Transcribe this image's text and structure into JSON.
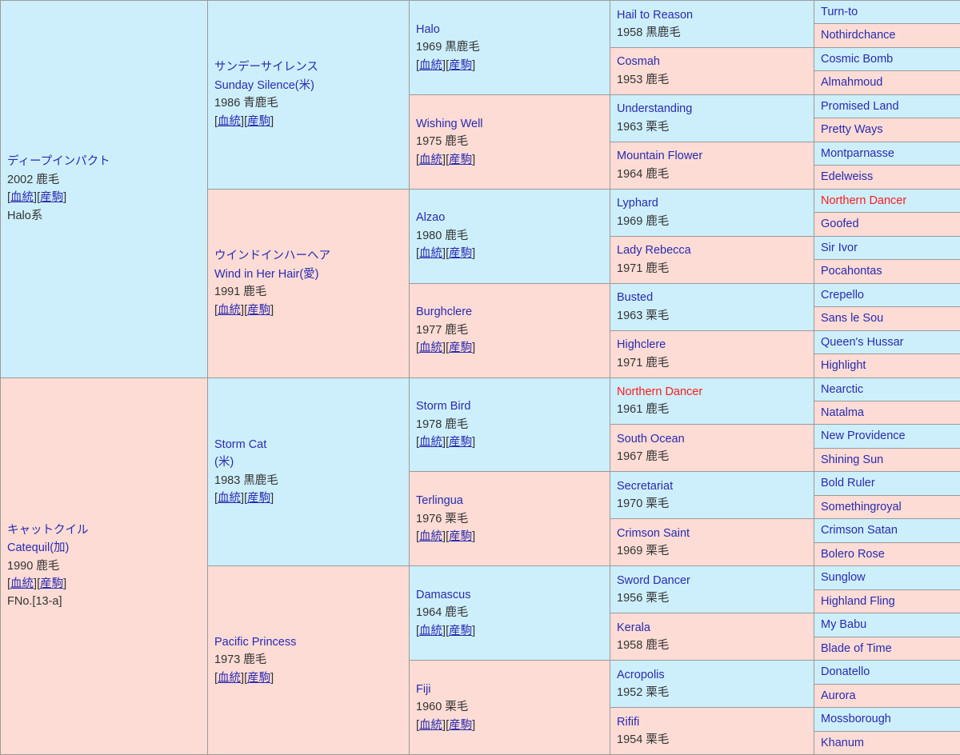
{
  "table": {
    "title": "馬血統表",
    "link_labels": {
      "pedigree": "血統",
      "offspring": "産駒"
    },
    "bracket_open": "[",
    "bracket_close": "]",
    "colors": {
      "sire_background": "#cdeffc",
      "dam_background": "#fcdcd5",
      "border": "#9a9a9a",
      "name_link": "#2a2ab0",
      "inbreeding_highlight": "#ff1a1a",
      "detail_text": "#333333"
    }
  },
  "subject": {
    "name_ja": "ディープインパクト",
    "detail": "2002 鹿毛",
    "family_line": "Halo系",
    "has_links": true
  },
  "generation1": [
    {
      "name_ja": "サンデーサイレンス",
      "name_en": "Sunday Silence(米)",
      "detail": "1986 青鹿毛",
      "has_links": true,
      "type": "sire"
    },
    {
      "name_ja": "ウインドインハーヘア",
      "name_en": "Wind in Her Hair(愛)",
      "detail": "1991 鹿毛",
      "has_links": true,
      "type": "dam"
    }
  ],
  "dam_side": {
    "name_ja": "キャットクイル",
    "name_en": "Catequil(加)",
    "detail": "1990 鹿毛",
    "family_number": "FNo.[13-a]",
    "has_links": true,
    "children": [
      {
        "name_en": "Storm Cat",
        "name_country": "(米)",
        "detail": "1983 黒鹿毛",
        "has_links": true,
        "type": "sire"
      },
      {
        "name_en": "Pacific Princess",
        "detail": "1973 鹿毛",
        "has_links": true,
        "type": "dam"
      }
    ]
  },
  "generation3": [
    {
      "name": "Halo",
      "detail": "1969 黒鹿毛",
      "has_links": true,
      "type": "sire",
      "inbred": false
    },
    {
      "name": "Wishing Well",
      "detail": "1975 鹿毛",
      "has_links": true,
      "type": "dam",
      "inbred": false
    },
    {
      "name": "Alzao",
      "detail": "1980 鹿毛",
      "has_links": true,
      "type": "sire",
      "inbred": false
    },
    {
      "name": "Burghclere",
      "detail": "1977 鹿毛",
      "has_links": true,
      "type": "dam",
      "inbred": false
    },
    {
      "name": "Storm Bird",
      "detail": "1978 鹿毛",
      "has_links": true,
      "type": "sire",
      "inbred": false
    },
    {
      "name": "Terlingua",
      "detail": "1976 栗毛",
      "has_links": true,
      "type": "dam",
      "inbred": false
    },
    {
      "name": "Damascus",
      "detail": "1964 鹿毛",
      "has_links": true,
      "type": "sire",
      "inbred": false
    },
    {
      "name": "Fiji",
      "detail": "1960 栗毛",
      "has_links": true,
      "type": "dam",
      "inbred": false
    }
  ],
  "generation4": [
    {
      "name": "Hail to Reason",
      "detail": "1958 黒鹿毛",
      "type": "sire",
      "inbred": false
    },
    {
      "name": "Cosmah",
      "detail": "1953 鹿毛",
      "type": "dam",
      "inbred": false
    },
    {
      "name": "Understanding",
      "detail": "1963 栗毛",
      "type": "sire",
      "inbred": false
    },
    {
      "name": "Mountain Flower",
      "detail": "1964 鹿毛",
      "type": "dam",
      "inbred": false
    },
    {
      "name": "Lyphard",
      "detail": "1969 鹿毛",
      "type": "sire",
      "inbred": false
    },
    {
      "name": "Lady Rebecca",
      "detail": "1971 鹿毛",
      "type": "dam",
      "inbred": false
    },
    {
      "name": "Busted",
      "detail": "1963 栗毛",
      "type": "sire",
      "inbred": false
    },
    {
      "name": "Highclere",
      "detail": "1971 鹿毛",
      "type": "dam",
      "inbred": false
    },
    {
      "name": "Northern Dancer",
      "detail": "1961 鹿毛",
      "type": "sire",
      "inbred": true
    },
    {
      "name": "South Ocean",
      "detail": "1967 鹿毛",
      "type": "dam",
      "inbred": false
    },
    {
      "name": "Secretariat",
      "detail": "1970 栗毛",
      "type": "sire",
      "inbred": false
    },
    {
      "name": "Crimson Saint",
      "detail": "1969 栗毛",
      "type": "dam",
      "inbred": false
    },
    {
      "name": "Sword Dancer",
      "detail": "1956 栗毛",
      "type": "sire",
      "inbred": false
    },
    {
      "name": "Kerala",
      "detail": "1958 鹿毛",
      "type": "dam",
      "inbred": false
    },
    {
      "name": "Acropolis",
      "detail": "1952 栗毛",
      "type": "sire",
      "inbred": false
    },
    {
      "name": "Rififi",
      "detail": "1954 栗毛",
      "type": "dam",
      "inbred": false
    }
  ],
  "generation5": [
    {
      "name": "Turn-to",
      "type": "sire",
      "inbred": false
    },
    {
      "name": "Nothirdchance",
      "type": "dam",
      "inbred": false
    },
    {
      "name": "Cosmic Bomb",
      "type": "sire",
      "inbred": false
    },
    {
      "name": "Almahmoud",
      "type": "dam",
      "inbred": false
    },
    {
      "name": "Promised Land",
      "type": "sire",
      "inbred": false
    },
    {
      "name": "Pretty Ways",
      "type": "dam",
      "inbred": false
    },
    {
      "name": "Montparnasse",
      "type": "sire",
      "inbred": false
    },
    {
      "name": "Edelweiss",
      "type": "dam",
      "inbred": false
    },
    {
      "name": "Northern Dancer",
      "type": "sire",
      "inbred": true
    },
    {
      "name": "Goofed",
      "type": "dam",
      "inbred": false
    },
    {
      "name": "Sir Ivor",
      "type": "sire",
      "inbred": false
    },
    {
      "name": "Pocahontas",
      "type": "dam",
      "inbred": false
    },
    {
      "name": "Crepello",
      "type": "sire",
      "inbred": false
    },
    {
      "name": "Sans le Sou",
      "type": "dam",
      "inbred": false
    },
    {
      "name": "Queen's Hussar",
      "type": "sire",
      "inbred": false
    },
    {
      "name": "Highlight",
      "type": "dam",
      "inbred": false
    },
    {
      "name": "Nearctic",
      "type": "sire",
      "inbred": false
    },
    {
      "name": "Natalma",
      "type": "dam",
      "inbred": false
    },
    {
      "name": "New Providence",
      "type": "sire",
      "inbred": false
    },
    {
      "name": "Shining Sun",
      "type": "dam",
      "inbred": false
    },
    {
      "name": "Bold Ruler",
      "type": "sire",
      "inbred": false
    },
    {
      "name": "Somethingroyal",
      "type": "dam",
      "inbred": false
    },
    {
      "name": "Crimson Satan",
      "type": "sire",
      "inbred": false
    },
    {
      "name": "Bolero Rose",
      "type": "dam",
      "inbred": false
    },
    {
      "name": "Sunglow",
      "type": "sire",
      "inbred": false
    },
    {
      "name": "Highland Fling",
      "type": "dam",
      "inbred": false
    },
    {
      "name": "My Babu",
      "type": "sire",
      "inbred": false
    },
    {
      "name": "Blade of Time",
      "type": "dam",
      "inbred": false
    },
    {
      "name": "Donatello",
      "type": "sire",
      "inbred": false
    },
    {
      "name": "Aurora",
      "type": "dam",
      "inbred": false
    },
    {
      "name": "Mossborough",
      "type": "sire",
      "inbred": false
    },
    {
      "name": "Khanum",
      "type": "dam",
      "inbred": false
    }
  ]
}
